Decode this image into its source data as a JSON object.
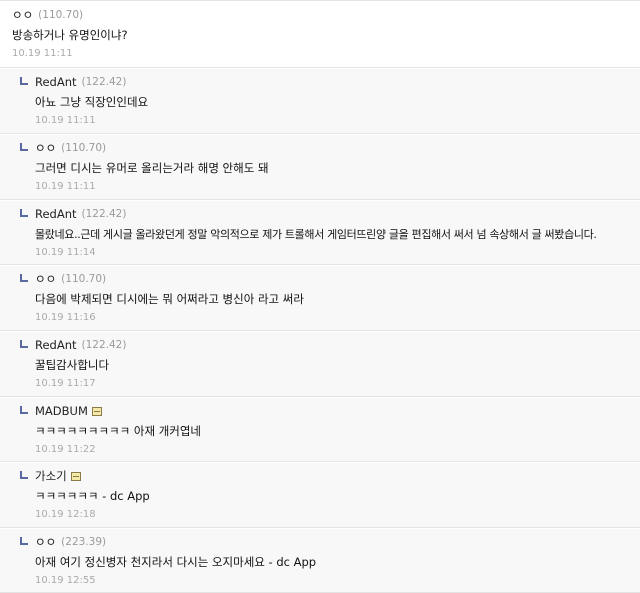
{
  "comments": [
    {
      "nick": "ㅇㅇ",
      "ip": "(110.70)",
      "text": "방송하거나 유명인이냐?",
      "date": "10.19 11:11",
      "reply": false,
      "memo": false
    },
    {
      "nick": "RedAnt",
      "ip": "(122.42)",
      "text": "아뇨 그냥 직장인인데요",
      "date": "10.19 11:11",
      "reply": true,
      "memo": false
    },
    {
      "nick": "ㅇㅇ",
      "ip": "(110.70)",
      "text": "그러면 디시는 유머로 올리는거라 해명 안해도 돼",
      "date": "10.19 11:11",
      "reply": true,
      "memo": false
    },
    {
      "nick": "RedAnt",
      "ip": "(122.42)",
      "text": "몰랐네요..근데 게시글 올라왔던게 정말 악의적으로 제가 트롤해서 게임터뜨린양 글을 편집해서 써서 넘 속상해서 글 써봤습니다.",
      "date": "10.19 11:14",
      "reply": true,
      "memo": false
    },
    {
      "nick": "ㅇㅇ",
      "ip": "(110.70)",
      "text": "다음에 박제되면 디시에는 뭐 어쩌라고 병신아 라고 써라",
      "date": "10.19 11:16",
      "reply": true,
      "memo": false
    },
    {
      "nick": "RedAnt",
      "ip": "(122.42)",
      "text": "꿀팁감사합니다",
      "date": "10.19 11:17",
      "reply": true,
      "memo": false
    },
    {
      "nick": "MADBUM",
      "ip": "",
      "text": "ㅋㅋㅋㅋㅋㅋㅋㅋㅋ 아재 개커엽네",
      "date": "10.19 11:22",
      "reply": true,
      "memo": true
    },
    {
      "nick": "가소기",
      "ip": "",
      "text": "ㅋㅋㅋㅋㅋㅋ - dc App",
      "date": "10.19 12:18",
      "reply": true,
      "memo": true
    },
    {
      "nick": "ㅇㅇ",
      "ip": "(223.39)",
      "text": "아재 여기 정신병자 천지라서 다시는 오지마세요 - dc App",
      "date": "10.19 12:55",
      "reply": true,
      "memo": false
    }
  ]
}
